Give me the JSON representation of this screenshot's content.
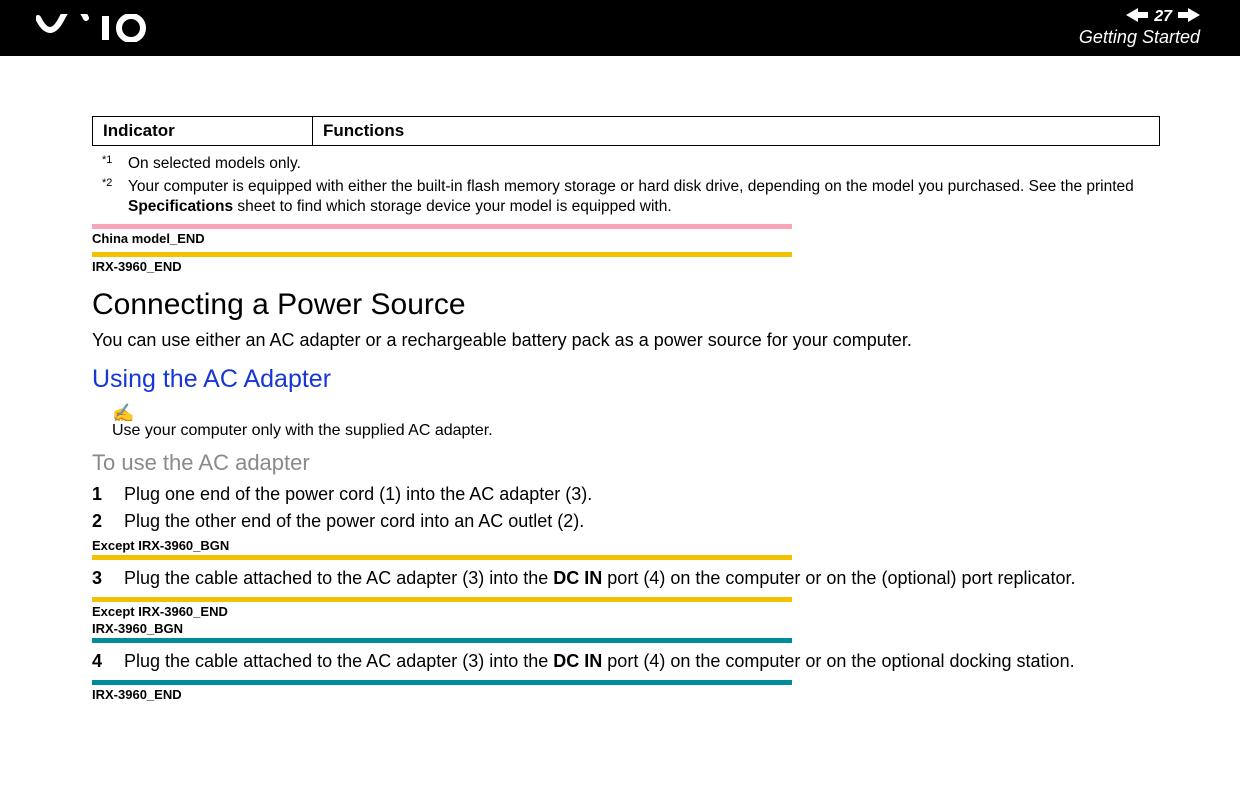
{
  "header": {
    "page_number": "27",
    "section_title": "Getting Started"
  },
  "table": {
    "col1": "Indicator",
    "col2": "Functions"
  },
  "footnotes": {
    "f1_mark": "*1",
    "f1_text": "On selected models only.",
    "f2_mark": "*2",
    "f2_text_a": "Your computer is equipped with either the built-in flash memory storage or hard disk drive, depending on the model you purchased. See the printed ",
    "f2_text_b": "Specifications",
    "f2_text_c": " sheet to find which storage device your model is equipped with."
  },
  "banners": {
    "china_end": "China model_END",
    "irx_end": "IRX-3960_END",
    "except_bgn": "Except IRX-3960_BGN",
    "except_end": "Except IRX-3960_END",
    "irx_bgn": "IRX-3960_BGN",
    "irx_end2": "IRX-3960_END"
  },
  "heading1": "Connecting a Power Source",
  "intro": "You can use either an AC adapter or a rechargeable battery pack as a power source for your computer.",
  "heading2": "Using the AC Adapter",
  "note_icon": "✍",
  "note_text": "Use your computer only with the supplied AC adapter.",
  "heading3": "To use the AC adapter",
  "steps": {
    "s1": {
      "n": "1",
      "t": "Plug one end of the power cord (1) into the AC adapter (3)."
    },
    "s2": {
      "n": "2",
      "t": "Plug the other end of the power cord into an AC outlet (2)."
    },
    "s3": {
      "n": "3",
      "pre": "Plug the cable attached to the AC adapter (3) into the ",
      "bold": "DC IN",
      "post": " port (4) on the computer or on the (optional) port replicator."
    },
    "s4": {
      "n": "4",
      "pre": "Plug the cable attached to the AC adapter (3) into the ",
      "bold": "DC IN",
      "post": " port (4) on the computer or on the optional docking station."
    }
  }
}
